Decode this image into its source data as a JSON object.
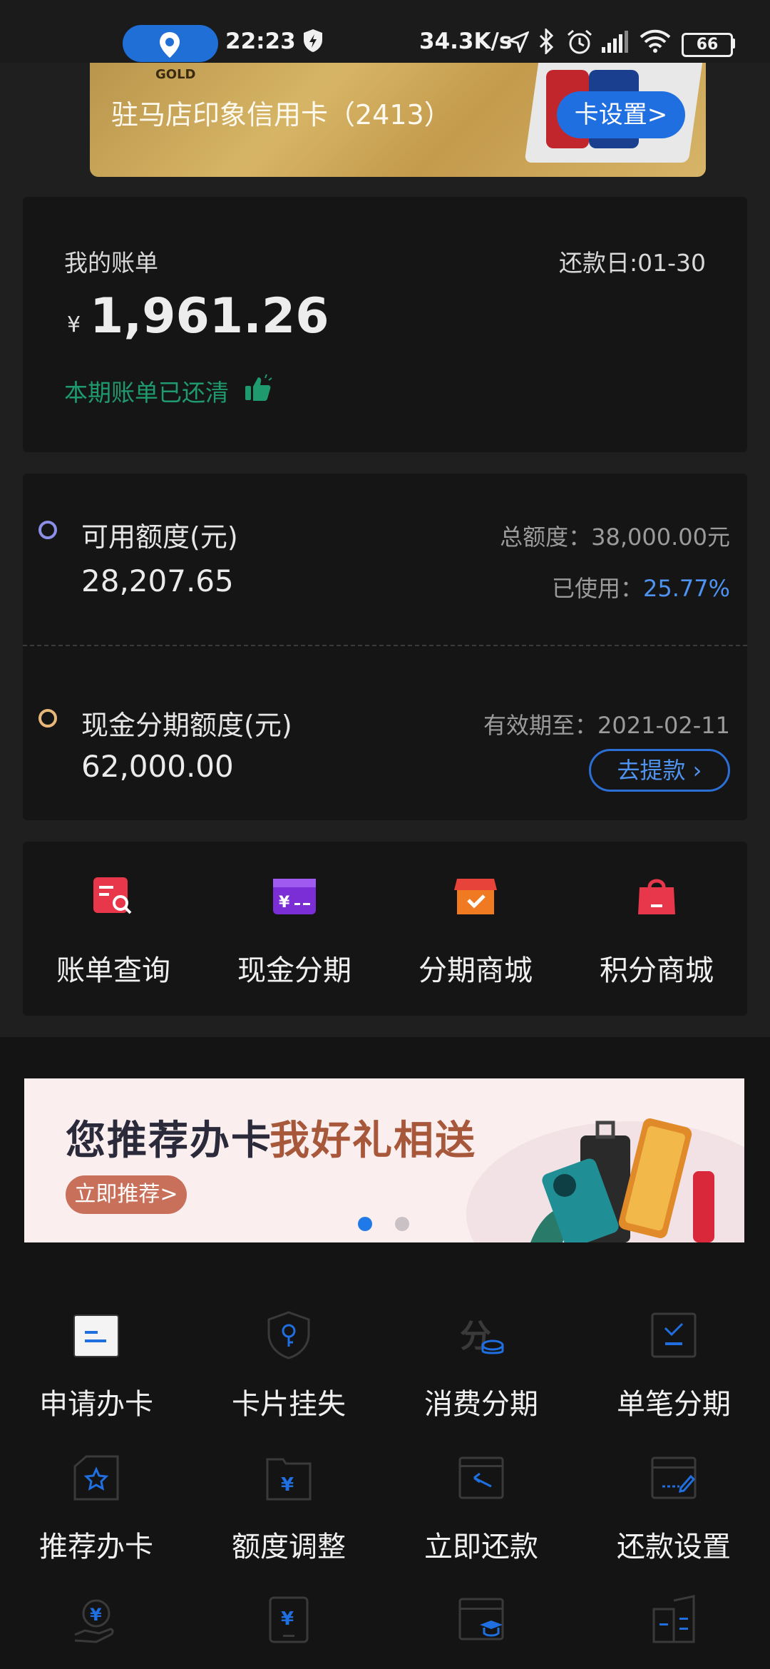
{
  "status_bar": {
    "time": "22:23",
    "speed": "34.3K/s",
    "battery": "66"
  },
  "card": {
    "tier": "GOLD",
    "name": "驻马店印象信用卡（2413）",
    "settings_label": "卡设置>"
  },
  "bill": {
    "title": "我的账单",
    "due_date": "还款日:01-30",
    "currency": "¥",
    "amount": "1,961.26",
    "status": "本期账单已还清"
  },
  "credit": {
    "available_label": "可用额度(元)",
    "available_value": "28,207.65",
    "total_label": "总额度：38,000.00元",
    "used_label": "已使用：",
    "used_value": "25.77%",
    "cash_label": "现金分期额度(元)",
    "cash_value": "62,000.00",
    "valid_until": "有效期至：2021-02-11",
    "withdraw_label": "去提款 ›"
  },
  "shortcuts": [
    {
      "label": "账单查询",
      "icon": "bill-search-icon"
    },
    {
      "label": "现金分期",
      "icon": "cash-installment-icon"
    },
    {
      "label": "分期商城",
      "icon": "installment-mall-icon"
    },
    {
      "label": "积分商城",
      "icon": "points-mall-icon"
    }
  ],
  "promo": {
    "title_part1": "您推荐办卡",
    "title_part2": "我好礼相送",
    "button": "立即推荐>",
    "page_index": 0,
    "page_count": 2
  },
  "services": [
    {
      "label": "申请办卡",
      "icon": "apply-card-icon"
    },
    {
      "label": "卡片挂失",
      "icon": "report-loss-icon"
    },
    {
      "label": "消费分期",
      "icon": "consumer-installment-icon"
    },
    {
      "label": "单笔分期",
      "icon": "single-installment-icon"
    },
    {
      "label": "推荐办卡",
      "icon": "recommend-card-icon"
    },
    {
      "label": "额度调整",
      "icon": "limit-adjust-icon"
    },
    {
      "label": "立即还款",
      "icon": "repay-now-icon"
    },
    {
      "label": "还款设置",
      "icon": "repay-settings-icon"
    },
    {
      "label": "",
      "icon": "hand-coin-icon"
    },
    {
      "label": "",
      "icon": "tablet-yen-icon"
    },
    {
      "label": "",
      "icon": "card-education-icon"
    },
    {
      "label": "",
      "icon": "building-icon"
    }
  ],
  "colors": {
    "accent_blue": "#1f6fe0",
    "success_green": "#1f9a6f",
    "used_percent": "#4f93f0"
  }
}
